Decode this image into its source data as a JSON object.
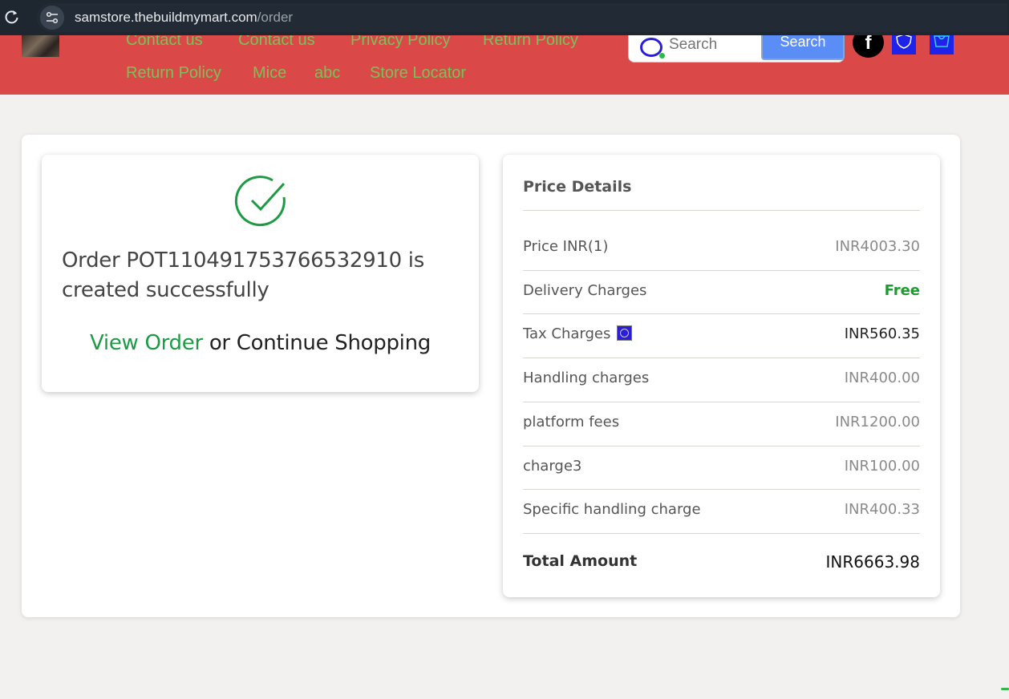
{
  "browser": {
    "url_host": "samstore.thebuildmymart.com",
    "url_path": "/order"
  },
  "header": {
    "nav_links": [
      "Contact us",
      "Contact us",
      "Privacy Policy",
      "Return Policy",
      "Return Policy",
      "Mice",
      "abc",
      "Store Locator"
    ],
    "search_placeholder": "Search",
    "search_button": "Search",
    "facebook_glyph": "f",
    "colors": {
      "header_bg": "#db4848",
      "nav_link": "#79c25a",
      "search_button": "#5b8df7"
    }
  },
  "order": {
    "message": "Order POT110491753766532910 is created successfully",
    "view_order": "View Order",
    "or_text": " or ",
    "continue_shopping": "Continue Shopping",
    "accent": "#1e9a45"
  },
  "price_details": {
    "title": "Price Details",
    "rows": [
      {
        "label": "Price INR(1)",
        "value": "INR4003.30"
      },
      {
        "label": "Delivery Charges",
        "value": "Free"
      },
      {
        "label": "Tax Charges",
        "value": "INR560.35",
        "icon": "info-icon"
      },
      {
        "label": "Handling charges",
        "value": "INR400.00"
      },
      {
        "label": "platform fees",
        "value": "INR1200.00"
      },
      {
        "label": "charge3",
        "value": "INR100.00"
      },
      {
        "label": "Specific handling charge",
        "value": "INR400.33"
      }
    ],
    "total_label": "Total Amount",
    "total_value": "INR6663.98"
  }
}
